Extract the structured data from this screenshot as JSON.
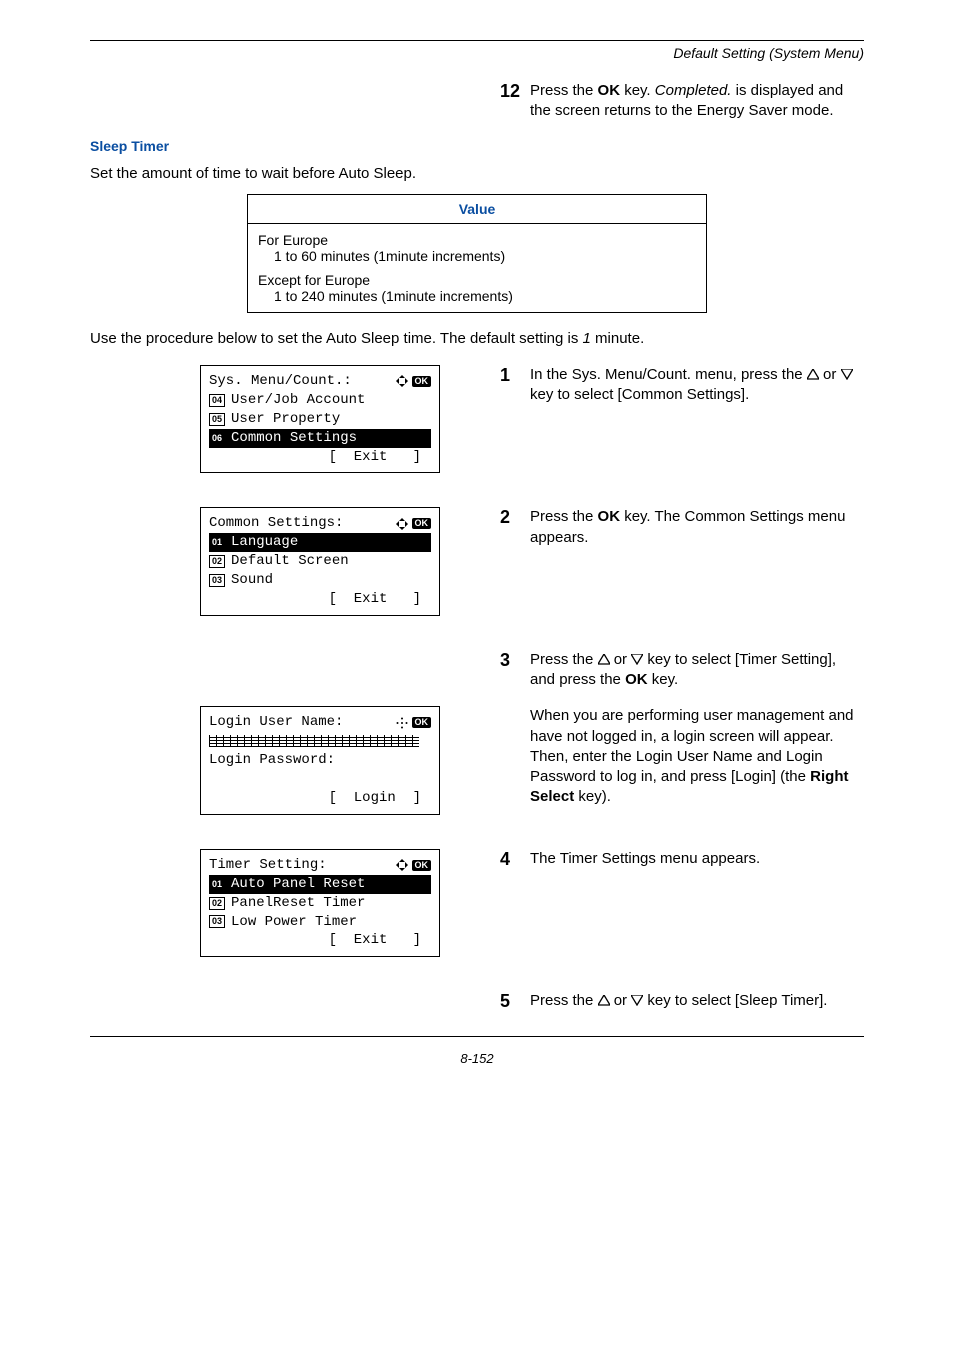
{
  "header": {
    "running": "Default Setting (System Menu)"
  },
  "intro_step": {
    "num": "12",
    "text_parts": [
      "Press the ",
      "OK",
      " key. ",
      "Completed.",
      " is displayed and the screen returns to the Energy Saver mode."
    ]
  },
  "section_title": "Sleep Timer",
  "section_intro": "Set the amount of time to wait before Auto Sleep.",
  "table": {
    "header": "Value",
    "rows": [
      {
        "head": "For Europe",
        "detail": "1 to 60 minutes (1minute increments)"
      },
      {
        "head": "Except for Europe",
        "detail": "1 to 240 minutes (1minute increments)"
      }
    ]
  },
  "procedure_intro_parts": [
    "Use the procedure below to set the Auto Sleep time. The default setting is ",
    "1",
    " minute."
  ],
  "lcd1": {
    "title": "Sys. Menu/Count.:",
    "items": [
      {
        "n": "04",
        "label": "User/Job Account",
        "hi": false
      },
      {
        "n": "05",
        "label": "User Property",
        "hi": false
      },
      {
        "n": "06",
        "label": "Common Settings",
        "hi": true
      }
    ],
    "soft": "[  Exit   ]"
  },
  "lcd2": {
    "title": "Common Settings:",
    "items": [
      {
        "n": "01",
        "label": "Language",
        "hi": true
      },
      {
        "n": "02",
        "label": "Default Screen",
        "hi": false
      },
      {
        "n": "03",
        "label": "Sound",
        "hi": false
      }
    ],
    "soft": "[  Exit   ]"
  },
  "lcd3": {
    "title": "Login User Name:",
    "pw_label": "Login Password:",
    "soft": "[  Login  ]"
  },
  "lcd4": {
    "title": "Timer Setting:",
    "items": [
      {
        "n": "01",
        "label": "Auto Panel Reset",
        "hi": true
      },
      {
        "n": "02",
        "label": "PanelReset Timer",
        "hi": false
      },
      {
        "n": "03",
        "label": "Low Power Timer",
        "hi": false
      }
    ],
    "soft": "[  Exit   ]"
  },
  "steps": {
    "s1": {
      "num": "1",
      "parts": [
        "In the Sys. Menu/Count. menu, press the ",
        " or ",
        " key to select [Common Settings]."
      ]
    },
    "s2": {
      "num": "2",
      "parts": [
        "Press the ",
        "OK",
        " key. The Common Settings menu appears."
      ]
    },
    "s3": {
      "num": "3",
      "parts": [
        "Press the ",
        " or ",
        " key to select [Timer Setting], and press the ",
        "OK",
        " key."
      ]
    },
    "s3b": {
      "parts": [
        "When you are performing user management and have not logged in, a login screen will appear. Then, enter the Login User Name and Login Password to log in, and press [Login] (the ",
        "Right Select",
        " key)."
      ]
    },
    "s4": {
      "num": "4",
      "text": "The Timer Settings menu appears."
    },
    "s5": {
      "num": "5",
      "parts": [
        "Press the ",
        " or ",
        " key to select [Sleep Timer]."
      ]
    }
  },
  "footer": "8-152"
}
